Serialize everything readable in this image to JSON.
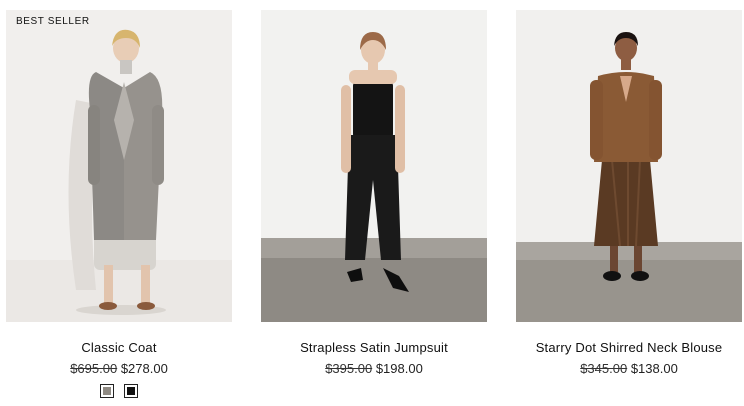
{
  "products": [
    {
      "badge": "BEST SELLER",
      "name": "Classic Coat",
      "price_original": "$695.00",
      "price_sale": "$278.00",
      "swatches": [
        {
          "color": "#8f8a83",
          "name": "heather grey"
        },
        {
          "color": "#111111",
          "name": "black"
        }
      ],
      "image_desc": "model in grey wool coat"
    },
    {
      "badge": "",
      "name": "Strapless Satin Jumpsuit",
      "price_original": "$395.00",
      "price_sale": "$198.00",
      "swatches": [],
      "image_desc": "model in black satin jumpsuit"
    },
    {
      "badge": "",
      "name": "Starry Dot Shirred Neck Blouse",
      "price_original": "$345.00",
      "price_sale": "$138.00",
      "swatches": [],
      "image_desc": "model in brown blouse and skirt"
    }
  ],
  "colors": {
    "text": "#111111",
    "background": "#ffffff"
  }
}
